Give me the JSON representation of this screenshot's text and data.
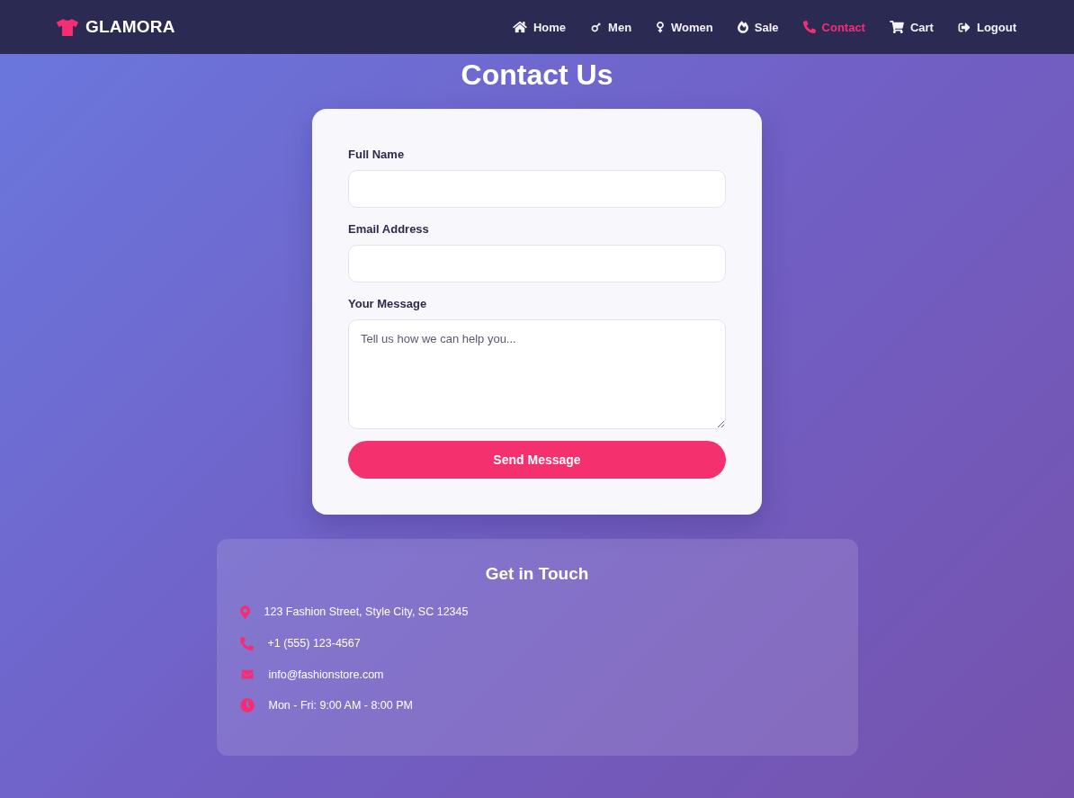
{
  "brand": {
    "name": "GLAMORA"
  },
  "nav": [
    {
      "label": "Home",
      "selected": false
    },
    {
      "label": "Men",
      "selected": false
    },
    {
      "label": "Women",
      "selected": false
    },
    {
      "label": "Sale",
      "selected": false
    },
    {
      "label": "Contact",
      "selected": true
    },
    {
      "label": "Cart",
      "selected": false
    },
    {
      "label": "Logout",
      "selected": false
    }
  ],
  "title": "Contact Us",
  "form": {
    "fields": [
      {
        "kind": "input",
        "label": "Full Name"
      },
      {
        "kind": "input",
        "label": "Email Address"
      },
      {
        "kind": "textarea",
        "label": "Your Message",
        "placeholder": "Tell us how we can help you..."
      }
    ],
    "submit": "Send Message"
  },
  "contact_info": {
    "title": "Get in Touch",
    "items": [
      {
        "text": "123 Fashion Street, Style City, SC 12345"
      },
      {
        "text": "+1 (555) 123-4567"
      },
      {
        "text": "info@fashionstore.com"
      },
      {
        "text": "Mon - Fri: 9:00 AM - 8:00 PM"
      }
    ]
  }
}
